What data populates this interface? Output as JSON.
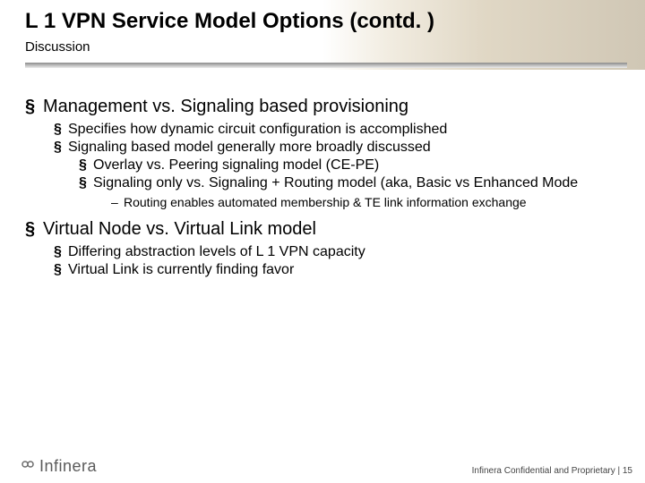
{
  "title": "L 1 VPN Service Model Options (contd. )",
  "subtitle": "Discussion",
  "bullets": {
    "a": {
      "text": "Management vs. Signaling based provisioning",
      "sub": {
        "a1": "Specifies how dynamic circuit configuration is accomplished",
        "a2": "Signaling based model generally more broadly discussed",
        "a2a": "Overlay vs. Peering signaling model (CE-PE)",
        "a2b": "Signaling only vs. Signaling + Routing model (aka, Basic vs Enhanced Mode",
        "a2b_d1": "Routing enables automated membership & TE link information exchange"
      }
    },
    "b": {
      "text": "Virtual Node vs. Virtual Link model",
      "sub": {
        "b1": "Differing abstraction levels of L 1 VPN capacity",
        "b2": "Virtual Link is currently finding favor"
      }
    }
  },
  "logo_text": "Infinera",
  "footer": {
    "confidential": "Infinera Confidential and Proprietary",
    "sep": "  |  ",
    "page": "15"
  },
  "marks": {
    "square": "§",
    "dash": "–"
  }
}
